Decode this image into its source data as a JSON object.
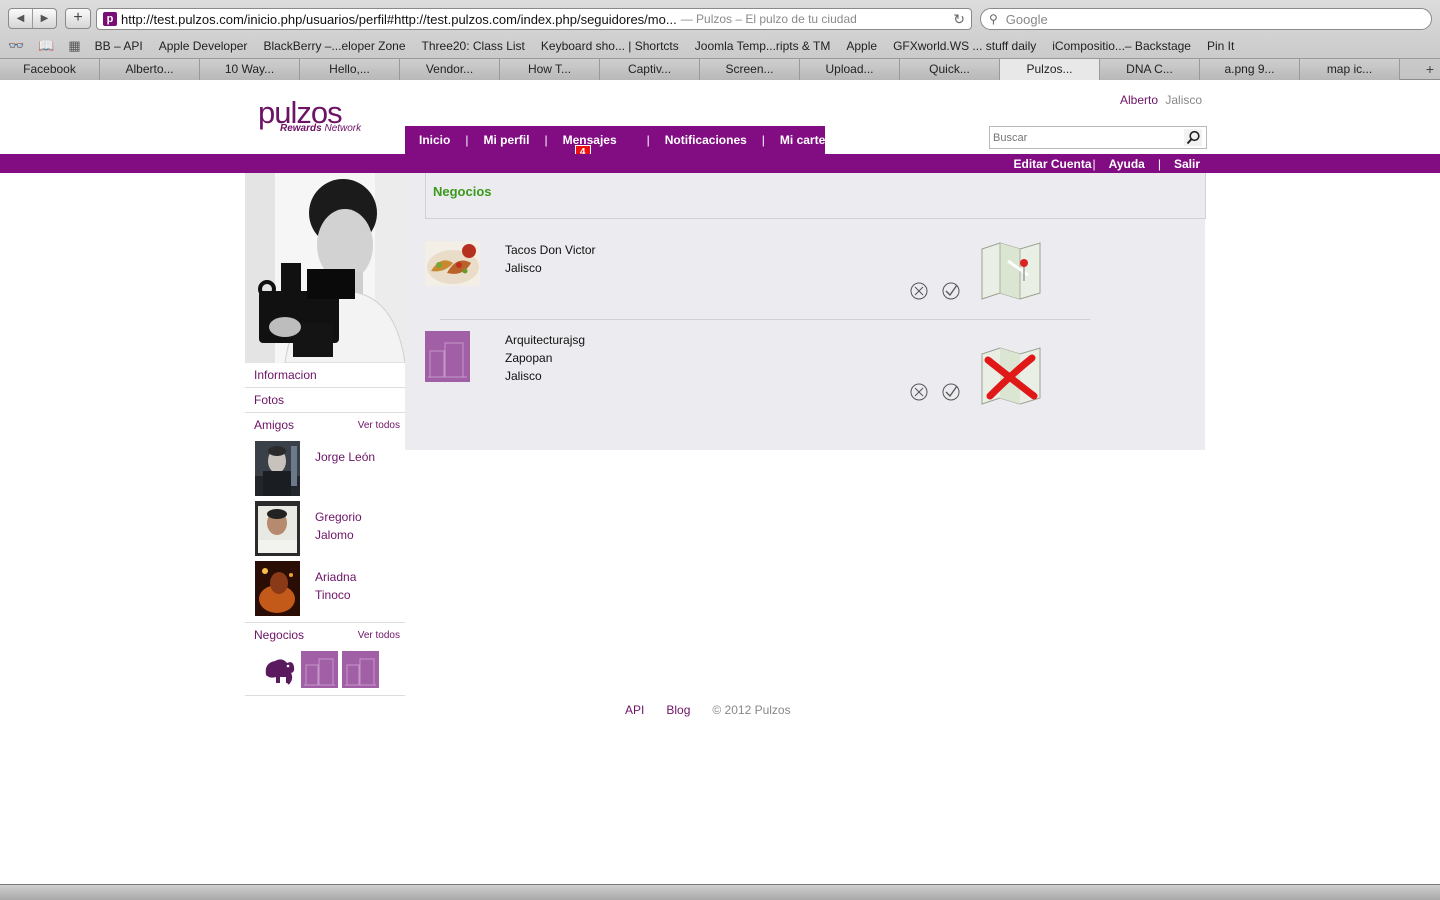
{
  "browser": {
    "url": "http://test.pulzos.com/inicio.php/usuarios/perfil#http://test.pulzos.com/index.php/seguidores/mo...",
    "page_title": "— Pulzos – El pulzo de tu ciudad",
    "search_placeholder": "Google",
    "bookmarks": [
      "BB – API",
      "Apple Developer",
      "BlackBerry –...eloper Zone",
      "Three20: Class List",
      "Keyboard sho... | Shortcts",
      "Joomla Temp...ripts & TM",
      "Apple",
      "GFXworld.WS ... stuff daily",
      "iCompositio...– Backstage",
      "Pin It"
    ],
    "tabs": [
      "Facebook",
      "Alberto...",
      "10 Way...",
      "Hello,...",
      "Vendor...",
      "How T...",
      "Captiv...",
      "Screen...",
      "Upload...",
      "Quick...",
      "Pulzos...",
      "DNA C...",
      "a.png 9...",
      "map ic..."
    ],
    "active_tab": "Pulzos..."
  },
  "site": {
    "logo_main": "pulzos",
    "logo_sub_bold": "Rewards",
    "logo_sub_rest": " Network",
    "user_name": "Alberto",
    "user_location": "Jalisco",
    "nav": {
      "inicio": "Inicio",
      "perfil": "Mi perfil",
      "mensajes": "Mensajes",
      "mensajes_badge": "4",
      "notificaciones": "Notificaciones",
      "cartera": "Mi cartera"
    },
    "search_placeholder": "Buscar",
    "subnav": {
      "editar": "Editar Cuenta",
      "ayuda": "Ayuda",
      "salir": "Salir"
    }
  },
  "sidebar": {
    "informacion": "Informacion",
    "fotos": "Fotos",
    "amigos_title": "Amigos",
    "amigos_ver_todos": "Ver todos",
    "friends": [
      {
        "name": "Jorge León"
      },
      {
        "name": "Gregorio Jalomo"
      },
      {
        "name": "Ariadna Tinoco"
      }
    ],
    "negocios_title": "Negocios",
    "negocios_ver_todos": "Ver todos"
  },
  "main": {
    "section_title": "Negocios",
    "businesses": [
      {
        "name": "Tacos Don Victor",
        "line2": "Jalisco",
        "line3": ""
      },
      {
        "name": "Arquitecturajsg",
        "line2": "Zapopan",
        "line3": "Jalisco"
      }
    ]
  },
  "footer": {
    "api": "API",
    "blog": "Blog",
    "copyright": "© 2012 Pulzos"
  }
}
